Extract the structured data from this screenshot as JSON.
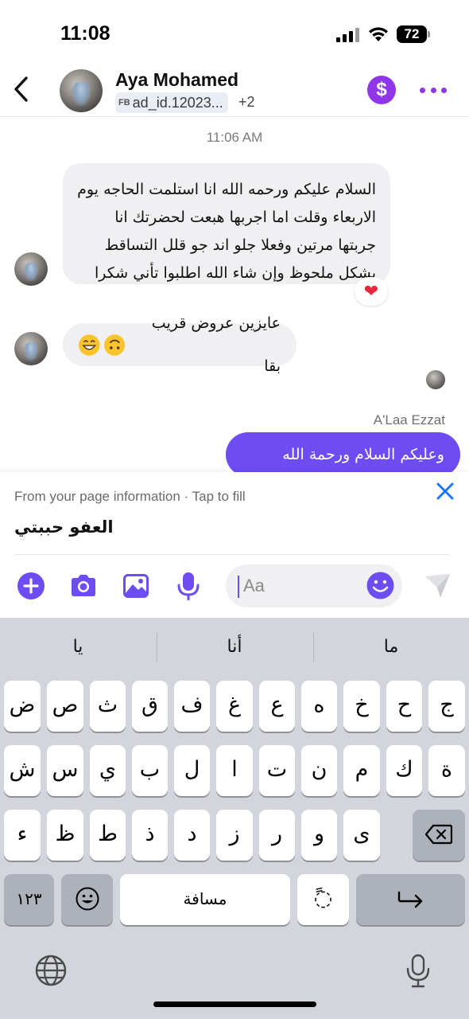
{
  "status_bar": {
    "time": "11:08",
    "battery": "72"
  },
  "header": {
    "contact_name": "Aya Mohamed",
    "ad_label": "FB",
    "ad_id": "ad_id.12023...",
    "extra_count": "+2",
    "dollar_symbol": "$"
  },
  "chat": {
    "timestamp": "11:06 AM",
    "messages": [
      {
        "direction": "incoming",
        "text": "السلام عليكم ورحمه الله انا استلمت الحاجه يوم الاربعاء وقلت اما اجربها هبعت لحضرتك انا جربتها مرتين وفعلا جلو اند جو قلل التساقط بشكل ملحوظ وإن شاء الله اطلبوا تأني شكرا",
        "reaction": "❤"
      },
      {
        "direction": "incoming",
        "text": "عايزين عروض قريب بقا",
        "emoji_count": 2
      }
    ],
    "reply_sender": "A'Laa Ezzat",
    "reply_text": "وعليكم السلام ورحمة الله وبركاته"
  },
  "suggestion": {
    "caption": "From your page information · Tap to fill",
    "text": "العفو حببتي"
  },
  "composer": {
    "placeholder": "Aa",
    "icons": [
      "plus-icon",
      "camera-icon",
      "image-icon",
      "microphone-icon",
      "emoji-icon",
      "send-icon"
    ],
    "accent": "#6d4cf2"
  },
  "keyboard": {
    "predictions": [
      "يا",
      "أنا",
      "ما"
    ],
    "row1": [
      "ض",
      "ص",
      "ث",
      "ق",
      "ف",
      "غ",
      "ع",
      "ه",
      "خ",
      "ح",
      "ج"
    ],
    "row2": [
      "ش",
      "س",
      "ي",
      "ب",
      "ل",
      "ا",
      "ت",
      "ن",
      "م",
      "ك",
      "ة"
    ],
    "row3": [
      "ء",
      "ظ",
      "ط",
      "ذ",
      "د",
      "ز",
      "ر",
      "و",
      "ى"
    ],
    "numbers_key": "١٢٣",
    "space_key": "مسافة",
    "diacritic_key": "◌ً"
  }
}
